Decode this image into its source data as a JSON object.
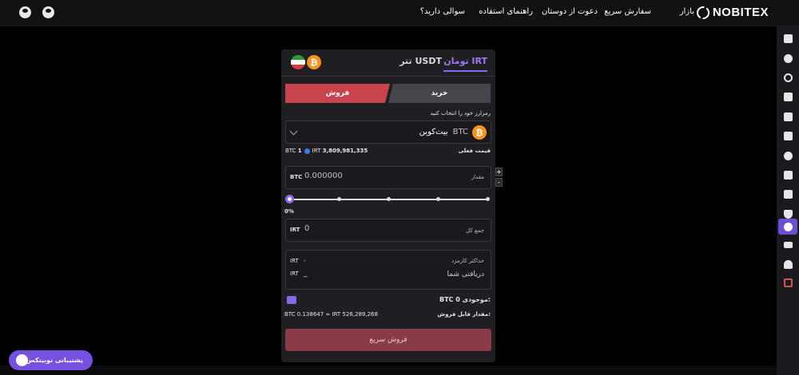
{
  "brand": {
    "name": "NOBITEX"
  },
  "nav": {
    "market": "بازار",
    "quick_order": "سفارش سریع",
    "invite": "دعوت از دوستان",
    "guide": "راهنمای استفاده",
    "faq": "سوالی دارید؟"
  },
  "tabs": [
    {
      "label": "تومان IRT",
      "active": true
    },
    {
      "label": "تتر USDT",
      "active": false
    }
  ],
  "trade": {
    "buy_label": "خرید",
    "sell_label": "فروش",
    "active": "sell"
  },
  "select_currency": {
    "label": "رمزارز خود را انتخاب کنید",
    "name": "بیت‌کوین",
    "symbol": "BTC"
  },
  "price": {
    "label": "قیمت فعلی",
    "value": "3,809,981,335",
    "currency": "IRT",
    "base_amount": "1",
    "base_unit": "BTC"
  },
  "amount": {
    "label": "مقدار",
    "value": "0.000000",
    "unit": "BTC",
    "plus": "+",
    "minus": "-"
  },
  "slider": {
    "percent_label": "0%",
    "value_percent": 0
  },
  "total": {
    "label": "جمع کل",
    "value": "0",
    "unit": "IRT"
  },
  "fees": {
    "max_fee_label": "حداکثر کارمزد",
    "max_fee_value": "-",
    "max_fee_unit": "IRT",
    "receive_label": "دریافتی شما",
    "receive_value": "_",
    "receive_unit": "IRT"
  },
  "balance": {
    "label": "موجودی:",
    "value": "0",
    "unit": "BTC"
  },
  "sellable": {
    "label": "مقدار قابل فروش:",
    "value": "BTC 0.138647 ≈ IRT 526,289,268"
  },
  "submit": {
    "label": "فروش سریع"
  },
  "support": {
    "label": "پشتیبانی نوبیتکس"
  },
  "colors": {
    "accent": "#8a68ee",
    "sell": "#c9434f",
    "panel": "#1f1f23"
  },
  "sidebar_icons": [
    "dashboard-icon",
    "network-icon",
    "refresh-icon",
    "wallet-icon",
    "chart-icon",
    "clipboard-icon",
    "bitcoin-icon",
    "profile-icon",
    "calendar-icon",
    "shield-check-icon",
    "download-icon",
    "mail-icon",
    "add-user-icon",
    "logout-icon"
  ]
}
